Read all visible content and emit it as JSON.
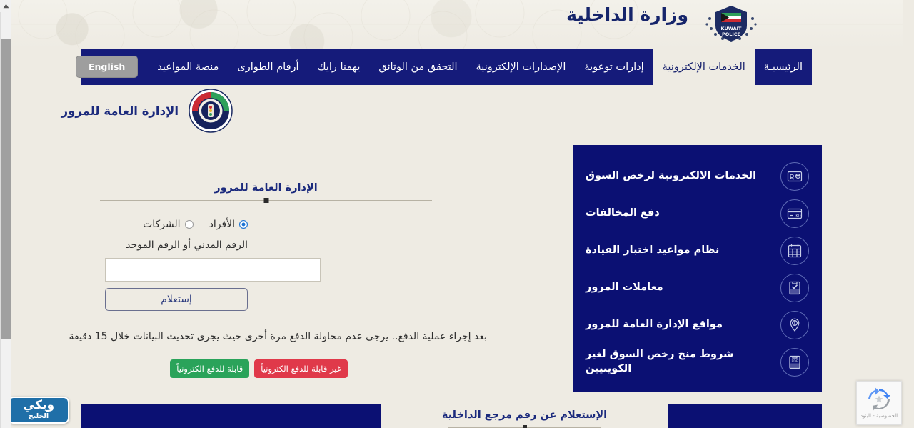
{
  "masthead": {
    "ministry_title": "وزارة الداخلية",
    "logo_name": "kuwait-police-emblem",
    "logo_text": "KUWAIT POLICE"
  },
  "nav": {
    "lang_button": "English",
    "items": [
      {
        "label": "الرئيسيـة",
        "active": false
      },
      {
        "label": "الخدمات الإلكترونية",
        "active": true
      },
      {
        "label": "إدارات توعوية",
        "active": false
      },
      {
        "label": "الإصدارات الإلكترونية",
        "active": false
      },
      {
        "label": "التحقق من الوثائق",
        "active": false
      },
      {
        "label": "يهمنا رايك",
        "active": false
      },
      {
        "label": "أرقام الطوارى",
        "active": false
      },
      {
        "label": "منصة المواعيد",
        "active": false
      }
    ]
  },
  "department": {
    "name": "الإدارة العامة للمرور",
    "emblem_name": "traffic-department-emblem"
  },
  "sidebar": {
    "items": [
      {
        "label": "الخدمات الالكترونية لرخص السوق",
        "icon": "license-card-icon"
      },
      {
        "label": "دفع المخالفات",
        "icon": "payment-card-kd-icon"
      },
      {
        "label": "نظام مواعيد اختبار القيادة",
        "icon": "calendar-icon"
      },
      {
        "label": "معاملات المرور",
        "icon": "document-check-icon"
      },
      {
        "label": "مواقع الإدارة العامة للمرور",
        "icon": "map-pin-icon"
      },
      {
        "label": "شروط منح رخص السوق لغير الكويتيين",
        "icon": "pdf-document-icon"
      }
    ]
  },
  "form": {
    "section_title": "الإدارة العامة للمرور",
    "radios": [
      {
        "label": "الأفراد",
        "checked": true
      },
      {
        "label": "الشركات",
        "checked": false
      }
    ],
    "field_label": "الرقم المدني أو الرقم الموحد",
    "input_value": "",
    "input_placeholder": "",
    "submit_label": "إستعلام",
    "notice": "بعد إجراء عملية الدفع.. يرجى عدم محاولة الدفع مرة أخرى حيث يجرى تحديث البيانات خلال 15 دقيقة",
    "legend": [
      {
        "label": "قابلة للدفع الكترونياً",
        "color": "#2aa35a"
      },
      {
        "label": "غير قابلة للدفع الكترونياً",
        "color": "#e0394a"
      }
    ]
  },
  "bottom": {
    "heading": "الإستعلام عن رقم مرجع الداخلية"
  },
  "watermark": {
    "top": "ويكي",
    "bottom": "الخليج"
  },
  "recaptcha": {
    "text": "الخصوصية - البنود",
    "icon": "recaptcha-icon"
  },
  "colors": {
    "nav_blue": "#151b7a",
    "panel_blue": "#0b1073",
    "page_background": "#eeebe3",
    "title_blue": "#1b2a7d",
    "accent_radio": "#1b73d4"
  }
}
